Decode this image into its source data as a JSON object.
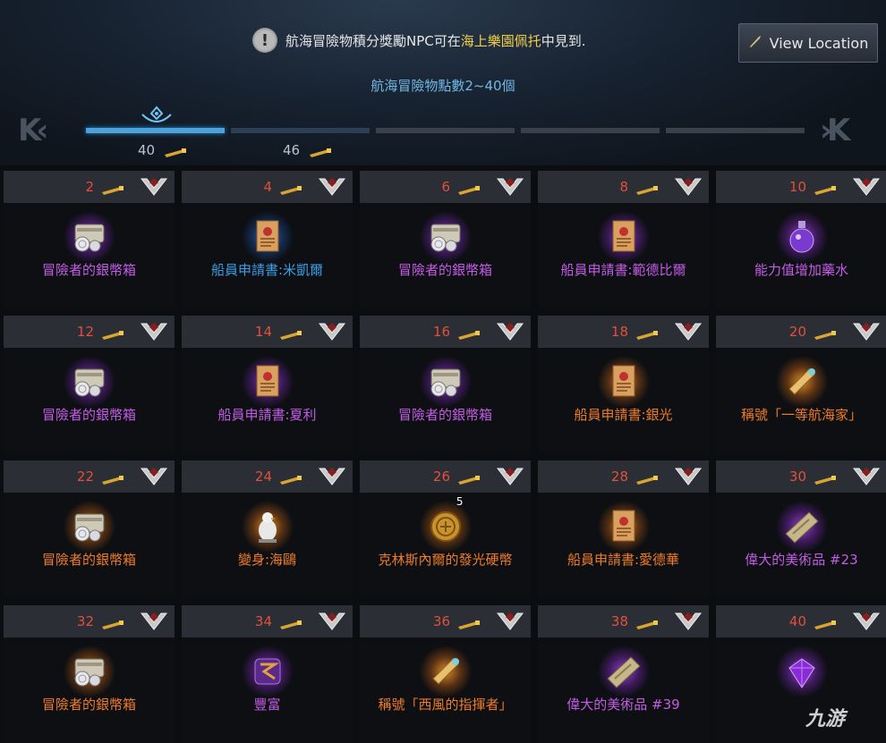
{
  "notice": {
    "prefix": "航海冒險物積分獎勵NPC可在",
    "highlight": "海上樂園佩托",
    "suffix": "中見到."
  },
  "view_button": {
    "label": "View Location"
  },
  "range_label": "航海冒險物點數2~40個",
  "progress": {
    "milestones": [
      {
        "value": "40"
      },
      {
        "value": "46"
      }
    ],
    "segments_total": 5,
    "segments_active": 1
  },
  "colors": {
    "purple": "#c45ce6",
    "blue": "#3a9fe6",
    "orange": "#ee7c28",
    "points": "#e0503d"
  },
  "rewards": [
    {
      "points": "2",
      "name": "冒險者的銀幣箱",
      "rarity": "purple",
      "icon": "silver-coin-chest-icon"
    },
    {
      "points": "4",
      "name": "船員申請書:米凱爾",
      "rarity": "blue",
      "icon": "crew-application-icon"
    },
    {
      "points": "6",
      "name": "冒險者的銀幣箱",
      "rarity": "purple",
      "icon": "silver-coin-chest-icon"
    },
    {
      "points": "8",
      "name": "船員申請書:範德比爾",
      "rarity": "purple",
      "icon": "crew-application-icon"
    },
    {
      "points": "10",
      "name": "能力值增加藥水",
      "rarity": "purple",
      "icon": "potion-icon"
    },
    {
      "points": "12",
      "name": "冒險者的銀幣箱",
      "rarity": "purple",
      "icon": "silver-coin-chest-icon"
    },
    {
      "points": "14",
      "name": "船員申請書:夏利",
      "rarity": "purple",
      "icon": "crew-application-icon"
    },
    {
      "points": "16",
      "name": "冒險者的銀幣箱",
      "rarity": "purple",
      "icon": "silver-coin-chest-icon"
    },
    {
      "points": "18",
      "name": "船員申請書:銀光",
      "rarity": "orange",
      "icon": "crew-application-icon"
    },
    {
      "points": "20",
      "name": "稱號「一等航海家」",
      "rarity": "orange",
      "icon": "title-scroll-icon"
    },
    {
      "points": "22",
      "name": "冒險者的銀幣箱",
      "rarity": "orange",
      "icon": "silver-coin-chest-icon"
    },
    {
      "points": "24",
      "name": "變身:海鷗",
      "rarity": "orange",
      "icon": "seagull-icon"
    },
    {
      "points": "26",
      "name": "克林斯內爾的發光硬幣",
      "rarity": "orange",
      "icon": "gold-coin-icon",
      "stack": "5"
    },
    {
      "points": "28",
      "name": "船員申請書:愛德華",
      "rarity": "orange",
      "icon": "crew-application-icon"
    },
    {
      "points": "30",
      "name": "偉大的美術品 #23",
      "rarity": "purple",
      "icon": "artwork-icon"
    },
    {
      "points": "32",
      "name": "冒險者的銀幣箱",
      "rarity": "orange",
      "icon": "silver-coin-chest-icon"
    },
    {
      "points": "34",
      "name": "豐富",
      "rarity": "purple",
      "icon": "rune-icon"
    },
    {
      "points": "36",
      "name": "稱號「西風的指揮者」",
      "rarity": "orange",
      "icon": "title-scroll-icon"
    },
    {
      "points": "38",
      "name": "偉大的美術品 #39",
      "rarity": "purple",
      "icon": "artwork-icon"
    },
    {
      "points": "40",
      "name": "",
      "rarity": "purple",
      "icon": "gem-icon"
    }
  ],
  "watermark": "九游"
}
